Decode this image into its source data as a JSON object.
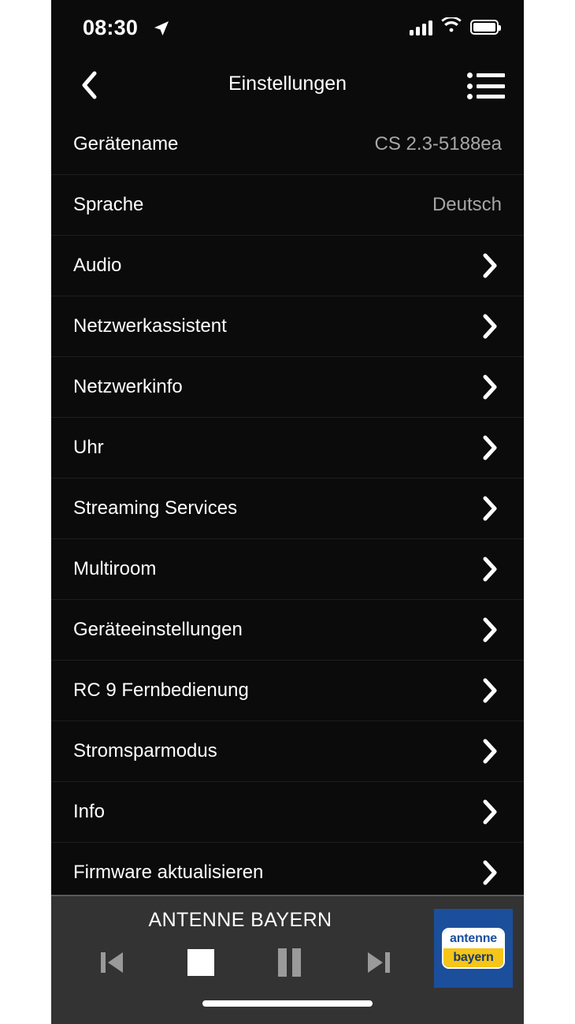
{
  "status_bar": {
    "time": "08:30",
    "location_icon": "location-arrow-icon",
    "signal_icon": "cellular-signal-icon",
    "wifi_icon": "wifi-icon",
    "battery_icon": "battery-full-icon"
  },
  "navbar": {
    "back_icon": "chevron-left-icon",
    "title": "Einstellungen",
    "menu_icon": "list-menu-icon"
  },
  "settings_list": [
    {
      "label": "Gerätename",
      "value": "CS 2.3-5188ea",
      "has_chevron": false
    },
    {
      "label": "Sprache",
      "value": "Deutsch",
      "has_chevron": false
    },
    {
      "label": "Audio",
      "value": "",
      "has_chevron": true
    },
    {
      "label": "Netzwerkassistent",
      "value": "",
      "has_chevron": true
    },
    {
      "label": "Netzwerkinfo",
      "value": "",
      "has_chevron": true
    },
    {
      "label": "Uhr",
      "value": "",
      "has_chevron": true
    },
    {
      "label": "Streaming Services",
      "value": "",
      "has_chevron": true
    },
    {
      "label": "Multiroom",
      "value": "",
      "has_chevron": true
    },
    {
      "label": "Geräteeinstellungen",
      "value": "",
      "has_chevron": true
    },
    {
      "label": "RC 9 Fernbedienung",
      "value": "",
      "has_chevron": true
    },
    {
      "label": "Stromsparmodus",
      "value": "",
      "has_chevron": true
    },
    {
      "label": "Info",
      "value": "",
      "has_chevron": true
    },
    {
      "label": "Firmware aktualisieren",
      "value": "",
      "has_chevron": true
    }
  ],
  "player": {
    "now_playing": "ANTENNE BAYERN",
    "controls": [
      {
        "name": "previous",
        "icon": "skip-previous-icon"
      },
      {
        "name": "stop",
        "icon": "stop-icon"
      },
      {
        "name": "pause",
        "icon": "pause-icon"
      },
      {
        "name": "next",
        "icon": "skip-next-icon"
      }
    ],
    "station_logo": {
      "top_text": "antenne",
      "bottom_text": "bayern",
      "background_color": "#1b4f9c",
      "accent_color": "#f5c518"
    }
  },
  "colors": {
    "screen_background": "#000000",
    "list_background": "#0b0b0b",
    "separator": "#1e1e1e",
    "primary_text": "#ffffff",
    "secondary_text": "#a6a6a6",
    "player_background": "#333333"
  }
}
